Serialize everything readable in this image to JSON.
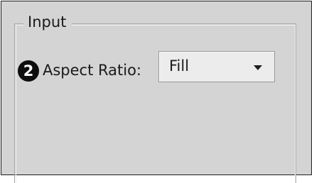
{
  "group": {
    "title": "Input"
  },
  "callout": {
    "number": "2"
  },
  "aspect_ratio": {
    "label": "Aspect Ratio:",
    "selected": "Fill"
  },
  "icons": {
    "dropdown": "chevron-down-icon",
    "callout": "numbered-callout-icon"
  },
  "colors": {
    "panel_background": "#d4d4d4",
    "callout_background": "#0d0d0d"
  }
}
